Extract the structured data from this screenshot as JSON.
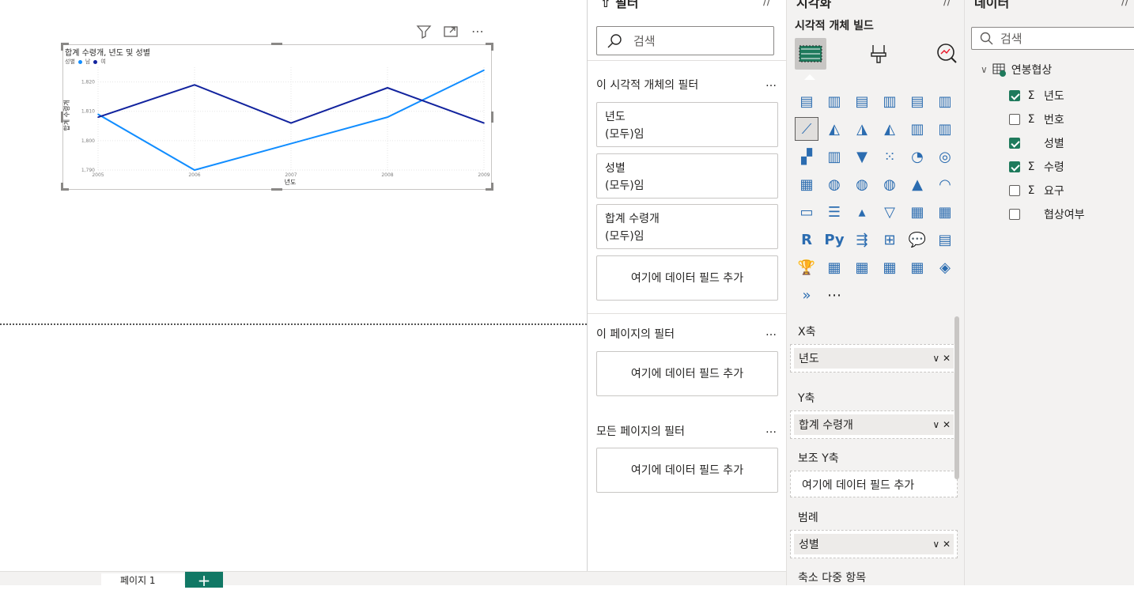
{
  "visual": {
    "toolbar": {
      "filter_icon": "filter-icon",
      "focus_icon": "focus-mode-icon",
      "more": "⋯"
    },
    "title": "합계 수령개, 년도 및 성별",
    "legend": {
      "label": "성별",
      "items": [
        "남",
        "여"
      ]
    },
    "ylabel": "합계 수령개",
    "xlabel": "년도"
  },
  "chart_data": {
    "type": "line",
    "title": "합계 수령개, 년도 및 성별",
    "xlabel": "년도",
    "ylabel": "합계 수령개",
    "x": [
      2005,
      2006,
      2007,
      2008,
      2009
    ],
    "x_ticks": [
      "2005",
      "2006",
      "2007",
      "2008",
      "2009"
    ],
    "y_ticks": [
      "1,790",
      "1,800",
      "1,810",
      "1,820"
    ],
    "ylim": [
      1790,
      1825
    ],
    "grid": true,
    "legend_position": "top-left",
    "series": [
      {
        "name": "남",
        "color": "#118dff",
        "values": [
          1809,
          1790,
          1799,
          1808,
          1824
        ]
      },
      {
        "name": "여",
        "color": "#12239e",
        "values": [
          1808,
          1819,
          1806,
          1818,
          1806
        ]
      }
    ]
  },
  "filter_pane": {
    "header": "필터",
    "search_placeholder": "검색",
    "visual_filters_title": "이 시각적 개체의 필터",
    "more": "…",
    "cards": [
      {
        "name": "년도",
        "state": "(모두)임"
      },
      {
        "name": "성별",
        "state": "(모두)임"
      },
      {
        "name": "합계 수령개",
        "state": "(모두)임"
      }
    ],
    "add_field": "여기에 데이터 필드 추가",
    "page_filters_title": "이 페이지의 필터",
    "all_pages_title": "모든 페이지의 필터"
  },
  "viz_pane": {
    "header": "시각화",
    "subtitle": "시각적 개체 빌드",
    "wells": {
      "x_label": "X축",
      "x_field": "년도",
      "y_label": "Y축",
      "y_field": "합계 수령개",
      "y2_label": "보조 Y축",
      "y2_empty": "여기에 데이터 필드 추가",
      "legend_label": "범례",
      "legend_field": "성별",
      "small_multiples_label": "축소 다중 항목"
    },
    "more": "⋯"
  },
  "data_pane": {
    "header": "데이터",
    "search_placeholder": "검색",
    "table": "연봉협상",
    "fields": [
      {
        "name": "년도",
        "checked": true,
        "sigma": true
      },
      {
        "name": "번호",
        "checked": false,
        "sigma": true
      },
      {
        "name": "성별",
        "checked": true,
        "sigma": false
      },
      {
        "name": "수령",
        "checked": true,
        "sigma": true
      },
      {
        "name": "요구",
        "checked": false,
        "sigma": true
      },
      {
        "name": "협상여부",
        "checked": false,
        "sigma": false
      }
    ]
  },
  "bottom": {
    "page_tab": "페이지 1",
    "add": "+"
  }
}
